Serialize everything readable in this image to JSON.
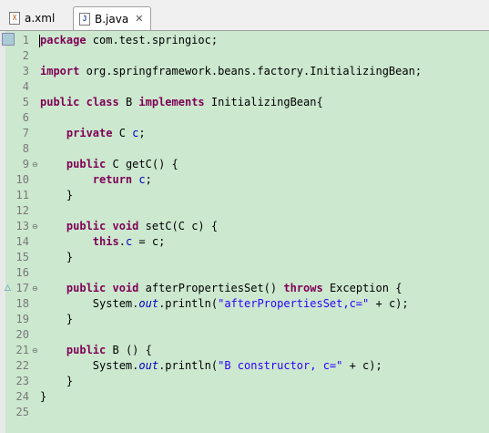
{
  "tabs": [
    {
      "label": "a.xml",
      "icon": "xml-file-icon",
      "active": false
    },
    {
      "label": "B.java",
      "icon": "java-file-icon",
      "active": true,
      "close": "✕"
    }
  ],
  "lines": [
    {
      "n": "1",
      "tokens": [
        [
          "",
          "package"
        ],
        [
          "p",
          " com.test.springioc;"
        ]
      ]
    },
    {
      "n": "2",
      "tokens": []
    },
    {
      "n": "3",
      "tokens": [
        [
          "kw",
          "import"
        ],
        [
          "p",
          " org.springframework.beans.factory.InitializingBean;"
        ]
      ]
    },
    {
      "n": "4",
      "tokens": []
    },
    {
      "n": "5",
      "tokens": [
        [
          "kw",
          "public"
        ],
        [
          "p",
          " "
        ],
        [
          "kw",
          "class"
        ],
        [
          "p",
          " B "
        ],
        [
          "kw",
          "implements"
        ],
        [
          "p",
          " InitializingBean{"
        ]
      ]
    },
    {
      "n": "6",
      "tokens": []
    },
    {
      "n": "7",
      "tokens": [
        [
          "p",
          "    "
        ],
        [
          "kw",
          "private"
        ],
        [
          "p",
          " C "
        ],
        [
          "fld",
          "c"
        ],
        [
          "p",
          ";"
        ]
      ]
    },
    {
      "n": "8",
      "tokens": []
    },
    {
      "n": "9",
      "tokens": [
        [
          "p",
          "    "
        ],
        [
          "kw",
          "public"
        ],
        [
          "p",
          " C getC() {"
        ]
      ],
      "fold": true
    },
    {
      "n": "10",
      "tokens": [
        [
          "p",
          "        "
        ],
        [
          "kw",
          "return"
        ],
        [
          "p",
          " "
        ],
        [
          "fld",
          "c"
        ],
        [
          "p",
          ";"
        ]
      ]
    },
    {
      "n": "11",
      "tokens": [
        [
          "p",
          "    }"
        ]
      ]
    },
    {
      "n": "12",
      "tokens": []
    },
    {
      "n": "13",
      "tokens": [
        [
          "p",
          "    "
        ],
        [
          "kw",
          "public"
        ],
        [
          "p",
          " "
        ],
        [
          "kw",
          "void"
        ],
        [
          "p",
          " setC(C c) {"
        ]
      ],
      "fold": true
    },
    {
      "n": "14",
      "tokens": [
        [
          "p",
          "        "
        ],
        [
          "kw",
          "this"
        ],
        [
          "p",
          "."
        ],
        [
          "fld",
          "c"
        ],
        [
          "p",
          " = c;"
        ]
      ]
    },
    {
      "n": "15",
      "tokens": [
        [
          "p",
          "    }"
        ]
      ]
    },
    {
      "n": "16",
      "tokens": []
    },
    {
      "n": "17",
      "tokens": [
        [
          "p",
          "    "
        ],
        [
          "kw",
          "public"
        ],
        [
          "p",
          " "
        ],
        [
          "kw",
          "void"
        ],
        [
          "p",
          " afterPropertiesSet() "
        ],
        [
          "kw",
          "throws"
        ],
        [
          "p",
          " Exception {"
        ]
      ],
      "fold": true,
      "override": true
    },
    {
      "n": "18",
      "tokens": [
        [
          "p",
          "        System."
        ],
        [
          "sf",
          "out"
        ],
        [
          "p",
          ".println("
        ],
        [
          "str",
          "\"afterPropertiesSet,c=\""
        ],
        [
          "p",
          " + c);"
        ]
      ]
    },
    {
      "n": "19",
      "tokens": [
        [
          "p",
          "    }"
        ]
      ]
    },
    {
      "n": "20",
      "tokens": []
    },
    {
      "n": "21",
      "tokens": [
        [
          "p",
          "    "
        ],
        [
          "kw",
          "public"
        ],
        [
          "p",
          " B () {"
        ]
      ],
      "fold": true
    },
    {
      "n": "22",
      "tokens": [
        [
          "p",
          "        System."
        ],
        [
          "sf",
          "out"
        ],
        [
          "p",
          ".println("
        ],
        [
          "str",
          "\"B constructor, c=\""
        ],
        [
          "p",
          " + c);"
        ]
      ]
    },
    {
      "n": "23",
      "tokens": [
        [
          "p",
          "    }"
        ]
      ]
    },
    {
      "n": "24",
      "tokens": [
        [
          "p",
          "}"
        ]
      ]
    },
    {
      "n": "25",
      "tokens": []
    }
  ],
  "first_line_keyword": "package"
}
